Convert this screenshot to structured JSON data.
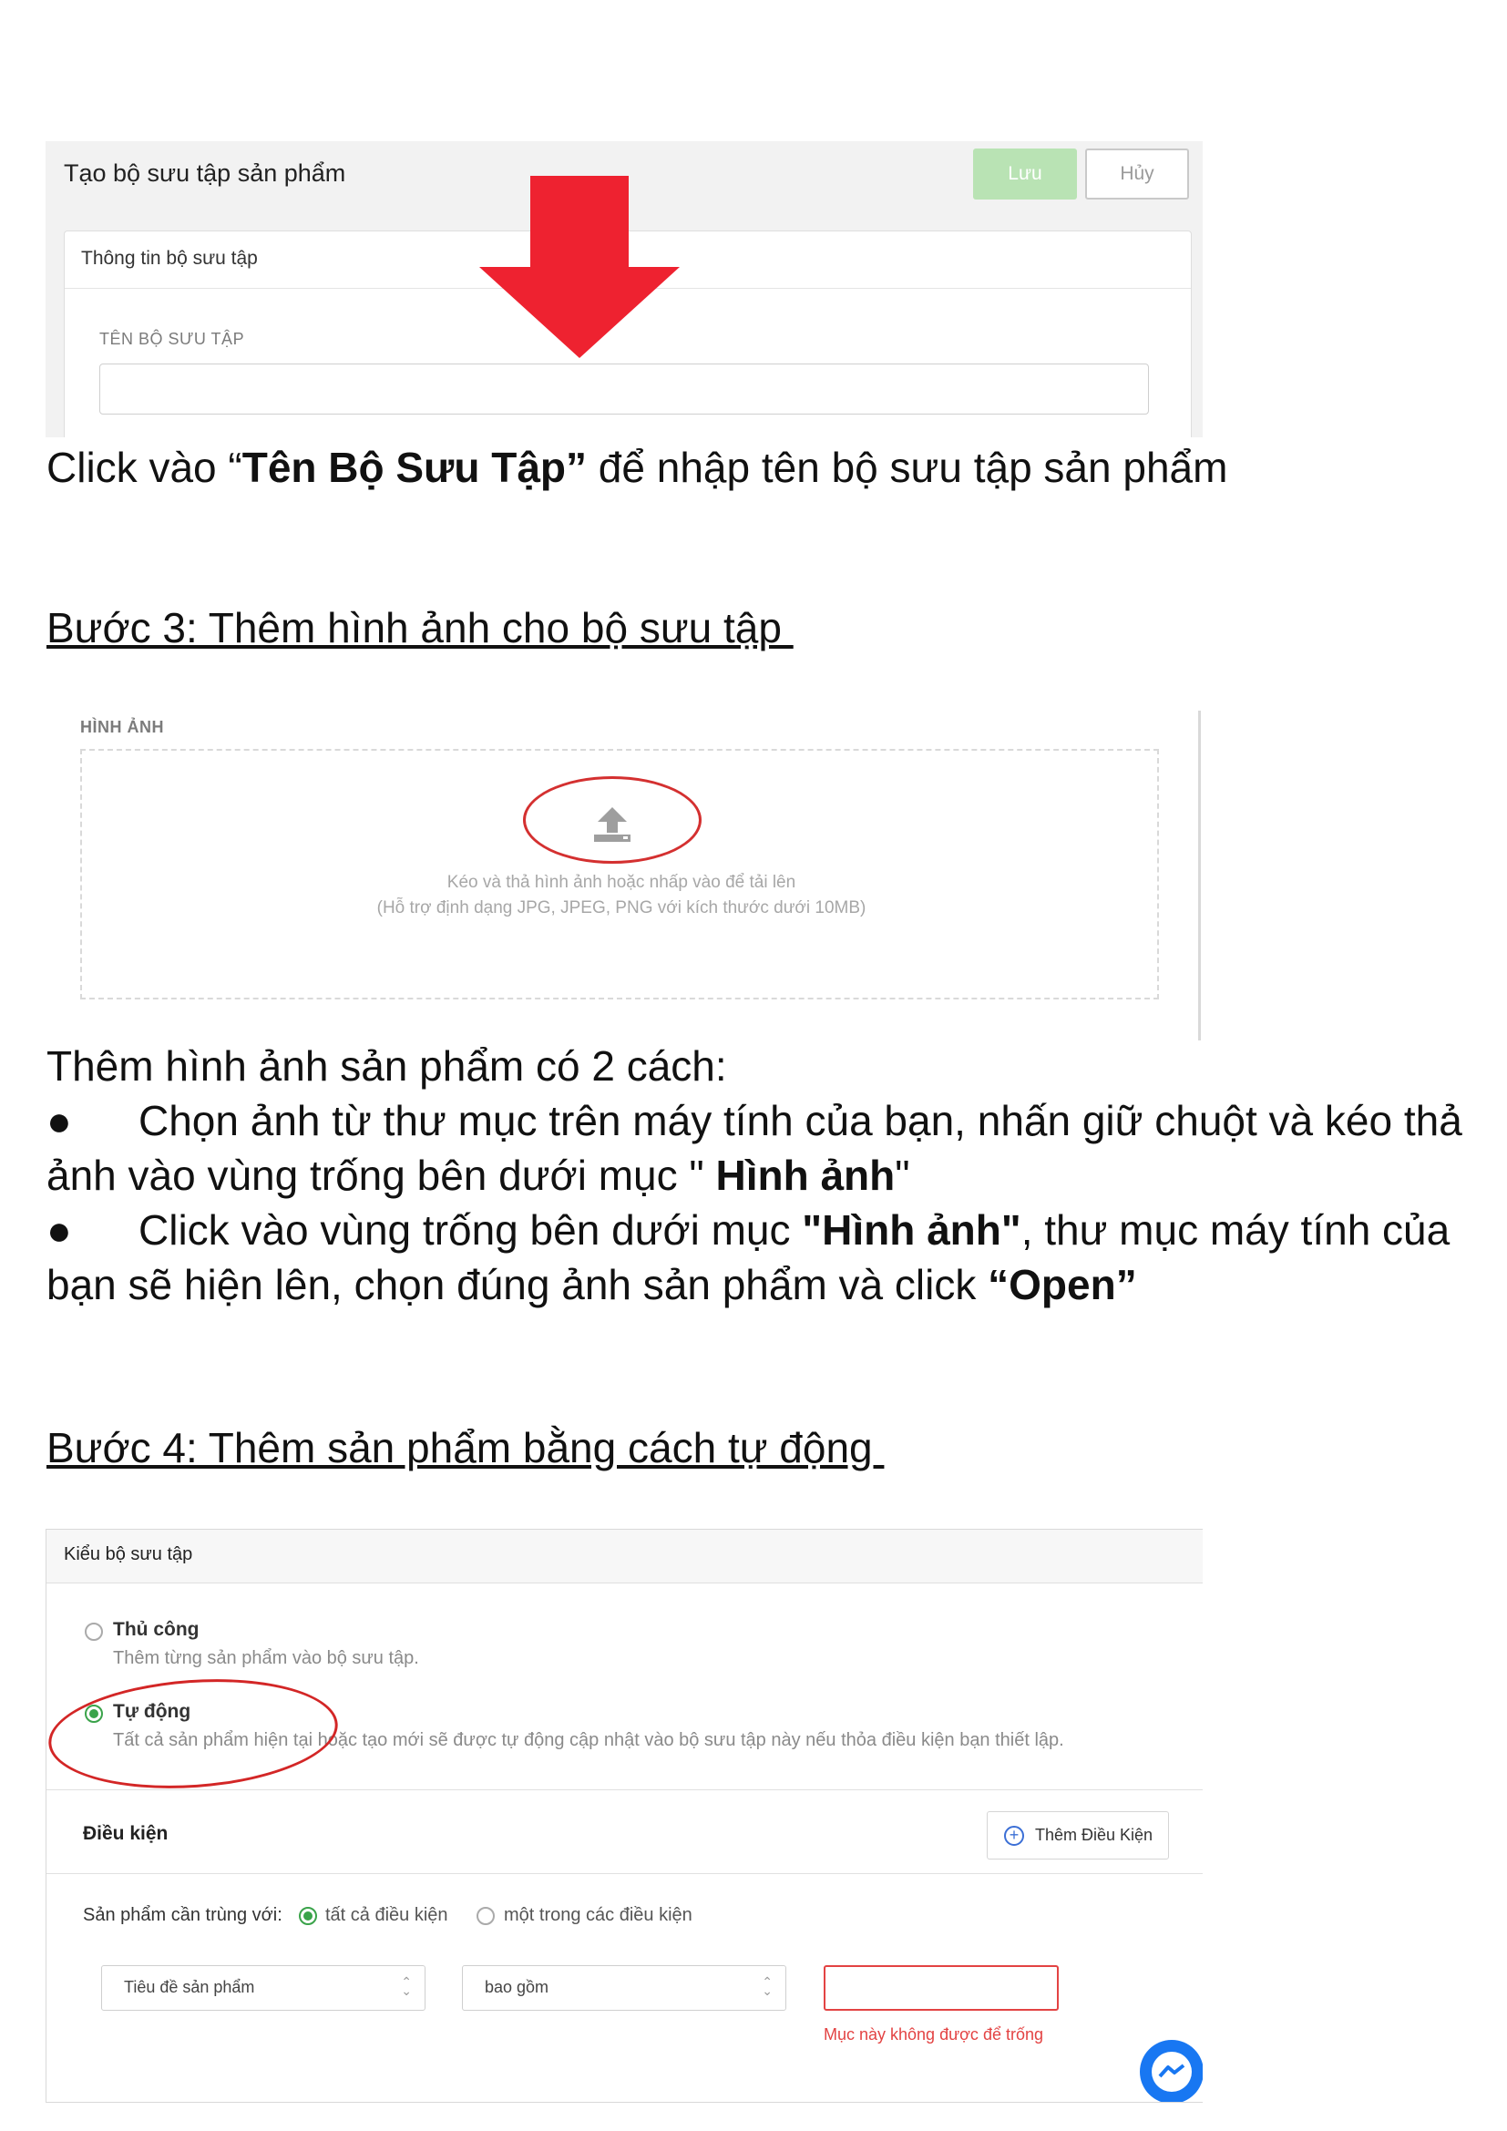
{
  "screenshot1": {
    "title": "Tạo bộ sưu tập sản phẩm",
    "save_label": "Lưu",
    "cancel_label": "Hủy",
    "panel_title": "Thông tin bộ sưu tập",
    "field_label": "TÊN BỘ SƯU TẬP",
    "field_value": "",
    "arrow_color": "#ee2230"
  },
  "caption1": {
    "pre": "Click vào “",
    "bold": "Tên Bộ Sưu Tập”",
    "post": " để nhập tên bộ sưu tập sản phẩm"
  },
  "step3_heading": "Bước 3: Thêm hình ảnh cho bộ sưu tập ",
  "screenshot2": {
    "label": "HÌNH ẢNH",
    "drop_line1": "Kéo và thả hình ảnh hoặc nhấp vào để tải lên",
    "drop_line2": "(Hỗ trợ định dạng JPG, JPEG, PNG với kích thước dưới 10MB)",
    "icon": "upload-icon"
  },
  "instructions": {
    "intro": "Thêm hình ảnh sản phẩm có 2 cách:",
    "bullet_glyph": "●",
    "b1_text": "Chọn ảnh từ thư mục trên máy tính của bạn, nhấn giữ chuột và kéo thả",
    "b1_cont_pre": "ảnh vào vùng trống bên dưới mục \" ",
    "b1_cont_bold": "Hình ảnh",
    "b1_cont_post": "\"",
    "b2_pre": "Click vào vùng trống bên dưới mục ",
    "b2_bold": "\"Hình ảnh\"",
    "b2_post": ", thư mục máy tính của",
    "b2_cont_pre": "bạn sẽ hiện lên, chọn đúng ảnh sản phẩm và click ",
    "b2_cont_bold": "“Open”"
  },
  "step4_heading": "Bước 4: Thêm sản phẩm bằng cách tự động ",
  "screenshot3": {
    "head_title": "Kiểu bộ sưu tập",
    "manual_title": "Thủ công",
    "manual_desc": "Thêm từng sản phẩm vào bộ sưu tập.",
    "auto_title": "Tự động",
    "auto_desc": "Tất cả sản phẩm hiện tại hoặc tạo mới sẽ được tự động cập nhật vào bộ sưu tập này nếu thỏa điều kiện bạn thiết lập.",
    "selected_type": "Tự động",
    "conditions_title": "Điều kiện",
    "add_condition_label": "Thêm Điều Kiện",
    "match_label": "Sản phẩm cần trùng với:",
    "match_all": "tất cả điều kiện",
    "match_any": "một trong các điều kiện",
    "selected_match": "tất cả điều kiện",
    "field_select": "Tiêu đề sản phẩm",
    "operator_select": "bao gồm",
    "value_input": "",
    "error_text": "Mục này không được để trống",
    "accent_color": "#3aa34a",
    "error_color": "#e34343"
  }
}
